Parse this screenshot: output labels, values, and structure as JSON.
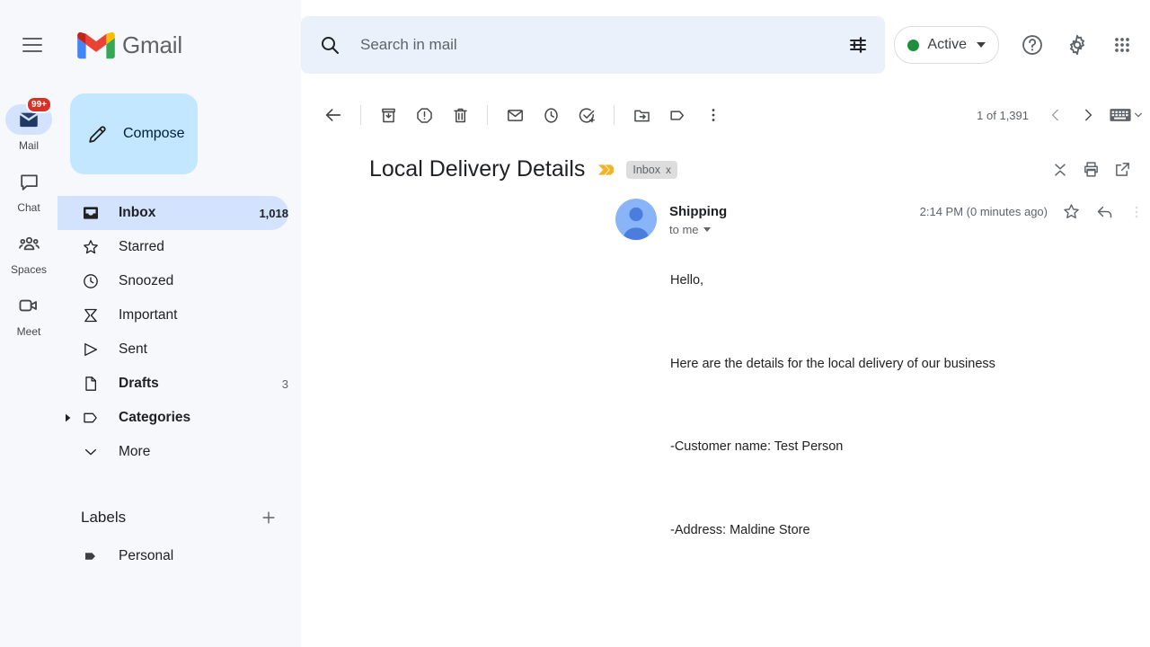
{
  "header": {
    "menu_icon": "hamburger-icon",
    "brand_name": "Gmail",
    "brand_logo_icon": "gmail-logo-icon",
    "search": {
      "icon": "search-icon",
      "placeholder": "Search in mail",
      "value": "",
      "options_icon": "search-options-icon"
    },
    "status": {
      "label": "Active",
      "dot_color": "#1e8e3e",
      "caret_icon": "chevron-down-icon"
    },
    "help_icon": "help-icon",
    "settings_icon": "gear-icon",
    "apps_icon": "apps-grid-icon"
  },
  "rail": {
    "items": [
      {
        "label": "Mail",
        "icon": "mail-icon",
        "badge": "99+",
        "active": true
      },
      {
        "label": "Chat",
        "icon": "chat-bubble-icon",
        "badge": "",
        "active": false
      },
      {
        "label": "Spaces",
        "icon": "spaces-people-icon",
        "badge": "",
        "active": false
      },
      {
        "label": "Meet",
        "icon": "meet-video-icon",
        "badge": "",
        "active": false
      }
    ]
  },
  "sidebar": {
    "compose": {
      "label": "Compose",
      "icon": "pencil-icon"
    },
    "nav_items": [
      {
        "label": "Inbox",
        "icon": "inbox-icon",
        "count": "1,018",
        "selected": true,
        "bold": false,
        "twisty": false
      },
      {
        "label": "Starred",
        "icon": "star-icon",
        "count": "",
        "selected": false,
        "bold": false,
        "twisty": false
      },
      {
        "label": "Snoozed",
        "icon": "clock-icon",
        "count": "",
        "selected": false,
        "bold": false,
        "twisty": false
      },
      {
        "label": "Important",
        "icon": "important-icon",
        "count": "",
        "selected": false,
        "bold": false,
        "twisty": false
      },
      {
        "label": "Sent",
        "icon": "send-icon",
        "count": "",
        "selected": false,
        "bold": false,
        "twisty": false
      },
      {
        "label": "Drafts",
        "icon": "draft-file-icon",
        "count": "3",
        "selected": false,
        "bold": true,
        "twisty": false
      },
      {
        "label": "Categories",
        "icon": "label-tag-icon",
        "count": "",
        "selected": false,
        "bold": true,
        "twisty": true
      },
      {
        "label": "More",
        "icon": "chevron-down-icon",
        "count": "",
        "selected": false,
        "bold": false,
        "twisty": false
      }
    ],
    "labels_section": {
      "title": "Labels",
      "add_icon": "plus-icon",
      "items": [
        {
          "label": "Personal",
          "icon": "label-filled-icon"
        }
      ]
    }
  },
  "toolbar": {
    "buttons": [
      {
        "name": "back-to-inbox",
        "icon": "arrow-left-icon"
      },
      {
        "name": "archive",
        "icon": "archive-icon"
      },
      {
        "name": "report-spam",
        "icon": "report-spam-icon"
      },
      {
        "name": "delete",
        "icon": "trash-icon"
      },
      {
        "name": "mark-unread",
        "icon": "envelope-icon"
      },
      {
        "name": "snooze",
        "icon": "clock-icon"
      },
      {
        "name": "add-to-tasks",
        "icon": "task-check-icon"
      },
      {
        "name": "move-to",
        "icon": "move-folder-icon"
      },
      {
        "name": "labels",
        "icon": "label-tag-icon"
      },
      {
        "name": "more-options",
        "icon": "more-vertical-icon"
      }
    ],
    "pagination": {
      "count_text": "1 of 1,391",
      "prev_icon": "chevron-left-icon",
      "next_icon": "chevron-right-icon",
      "keyboard_icon": "keyboard-icon",
      "keyboard_caret_icon": "chevron-down-icon"
    }
  },
  "email": {
    "subject": "Local Delivery Details",
    "importance_marker_icon": "importance-marker-icon",
    "label_chip": {
      "text": "Inbox",
      "remove": "x"
    },
    "header_icons": [
      {
        "name": "collapse-all",
        "icon": "collapse-all-icon"
      },
      {
        "name": "print-all",
        "icon": "print-icon"
      },
      {
        "name": "open-in-new-window",
        "icon": "open-in-new-icon"
      }
    ],
    "sender": {
      "name": "Shipping",
      "to": "to me",
      "details_caret_icon": "chevron-down-icon",
      "avatar_icon": "person-avatar-icon"
    },
    "timestamp": "2:14 PM (0 minutes ago)",
    "star_icon": "star-icon",
    "reply_icon": "reply-arrow-icon",
    "more_icon": "more-vertical-icon",
    "body_paragraphs": [
      "Hello,",
      "Here are the details for the local delivery of our business",
      "-Customer name: Test Person",
      "-Address: Maldine Store"
    ]
  },
  "colors": {
    "accent_blue": "#d3e3fd",
    "compose_blue": "#c2e7ff",
    "sidebar_bg": "#f6f8fc",
    "search_bg": "#eaf1fb",
    "badge_red": "#d93025",
    "active_green": "#1e8e3e",
    "importance_yellow": "#f0b429"
  }
}
